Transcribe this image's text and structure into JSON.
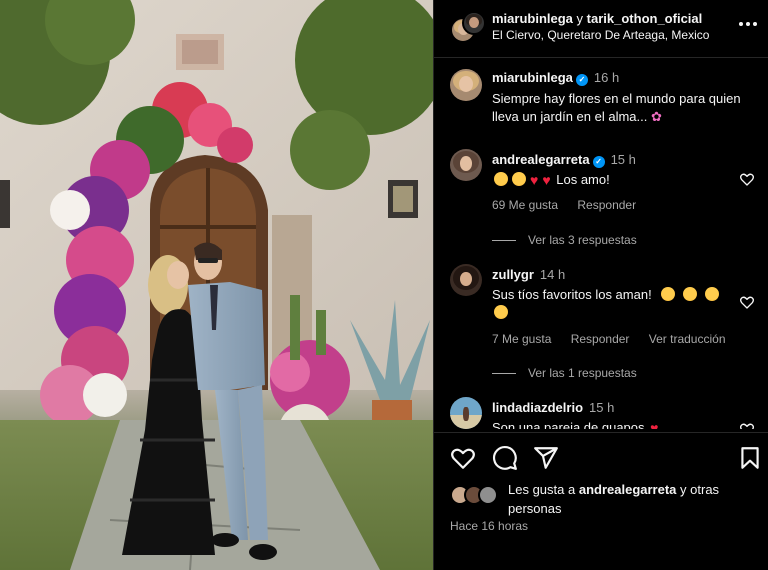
{
  "header": {
    "user1": "miarubinlega",
    "conjunction": "y",
    "user2": "tarik_othon_oficial",
    "location": "El Ciervo, Queretaro De Arteaga, Mexico",
    "more_icon": "more-horizontal-icon"
  },
  "comments": [
    {
      "username": "miarubinlega",
      "verified": true,
      "time": "16 h",
      "text": "Siempre hay flores en el mundo para quien lleva un jardín en el alma...",
      "emoji": "cherry-blossom-icon"
    },
    {
      "username": "andrealegarreta",
      "verified": true,
      "time": "15 h",
      "text": "Los amo!",
      "likes": "69 Me gusta",
      "reply": "Responder",
      "view_replies": "Ver las 3 respuestas"
    },
    {
      "username": "zullygr",
      "verified": false,
      "time": "14 h",
      "text": "Sus tíos favoritos los aman!",
      "likes": "7 Me gusta",
      "reply": "Responder",
      "translate": "Ver traducción",
      "view_replies": "Ver las 1 respuestas"
    },
    {
      "username": "lindadiazdelrio",
      "verified": false,
      "time": "15 h",
      "text": "Son una pareja de guapos"
    }
  ],
  "actions": {
    "like_icon": "heart-icon",
    "comment_icon": "comment-icon",
    "share_icon": "send-icon",
    "save_icon": "bookmark-icon"
  },
  "likes": {
    "prefix": "Les gusta a",
    "user": "andrealegarreta",
    "suffix": "y otras personas"
  },
  "posted": "Hace 16 horas",
  "colors": {
    "background": "#000000",
    "text": "#f5f5f5",
    "muted": "#a8a8a8",
    "verified": "#0095f6",
    "heart": "#f0223f"
  }
}
